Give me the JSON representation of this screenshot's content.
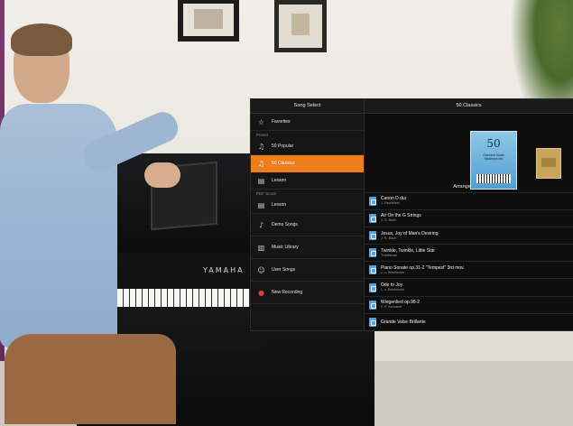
{
  "sidebar": {
    "title": "Song Select",
    "favorites_label": "Favorites",
    "preset_section": "Preset",
    "items_preset": [
      {
        "label": "50 Popular",
        "icon": "music-notes-icon",
        "selected": false
      },
      {
        "label": "50 Classics",
        "icon": "music-notes-icon",
        "selected": true
      },
      {
        "label": "Lesson",
        "icon": "book-icon",
        "selected": false
      }
    ],
    "pdf_section": "PDF Score",
    "items_pdf": [
      {
        "label": "Lesson",
        "icon": "book-icon"
      }
    ],
    "items_other": [
      {
        "label": "Demo Songs",
        "icon": "piano-icon"
      },
      {
        "label": "Music Library",
        "icon": "library-icon"
      },
      {
        "label": "User Songs",
        "icon": "user-icon"
      },
      {
        "label": "New Recording",
        "icon": "record-icon"
      }
    ]
  },
  "main": {
    "title": "50 Classics",
    "cover": {
      "number": "50",
      "subtitle": "Classical Music Masterpieces"
    },
    "arrangements_label": "Arrangements",
    "songs": [
      {
        "title": "Canon D dur",
        "composer": "J. Pachelbel"
      },
      {
        "title": "Air On the G Strings",
        "composer": "J. S. Bach"
      },
      {
        "title": "Jesus, Joy of Man's Desiring",
        "composer": "J. S. Bach"
      },
      {
        "title": "Twinkle, Twinkle, Little Star",
        "composer": "Traditional"
      },
      {
        "title": "Piano Sonate op.31-2 \"Tempest\" 3rd mov.",
        "composer": "L. v. Beethoven"
      },
      {
        "title": "Ode to Joy",
        "composer": "L. v. Beethoven"
      },
      {
        "title": "Wiegenlied op.98-2",
        "composer": "F. P. Schubert"
      },
      {
        "title": "Grande Valse Brillante",
        "composer": ""
      }
    ]
  },
  "piano_brand": "YAMAHA"
}
